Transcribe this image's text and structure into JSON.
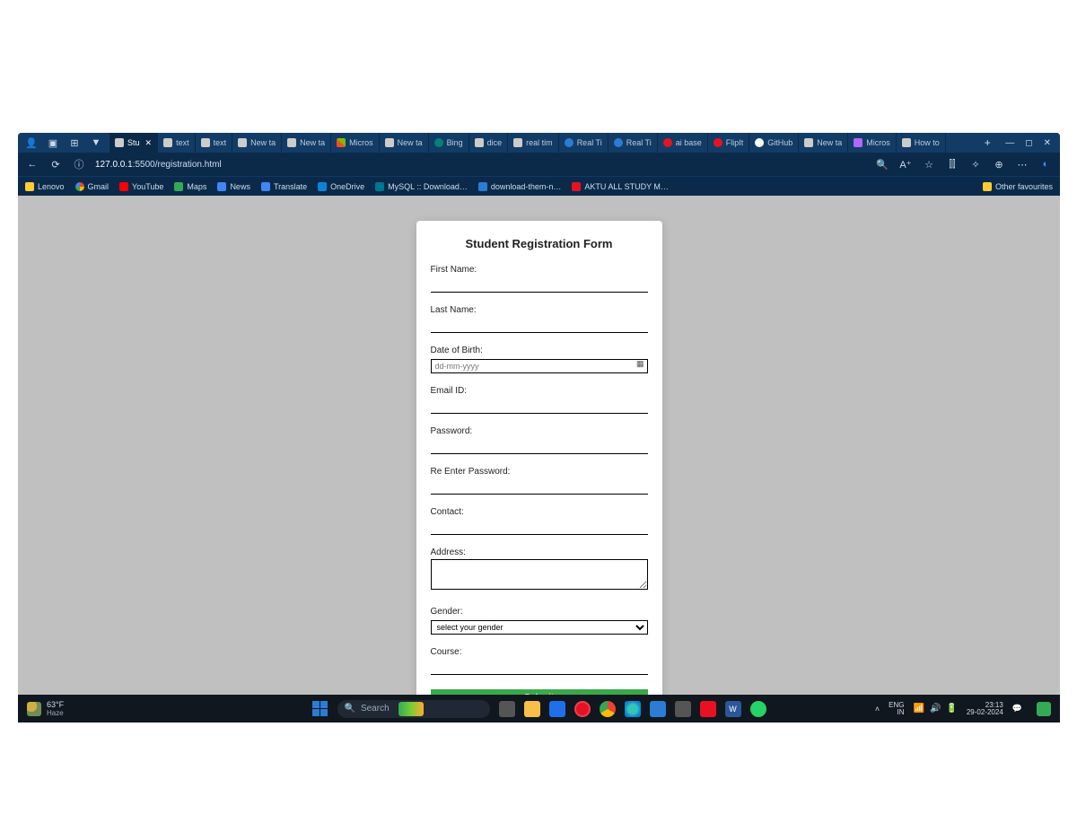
{
  "browser": {
    "url_prefix": "127.0.0.1",
    "url_rest": ":5500/registration.html",
    "tabs": [
      {
        "label": "Stu",
        "icon": "file",
        "active": true
      },
      {
        "label": "text",
        "icon": "file"
      },
      {
        "label": "text",
        "icon": "file"
      },
      {
        "label": "New ta",
        "icon": "file"
      },
      {
        "label": "New ta",
        "icon": "file"
      },
      {
        "label": "Micros",
        "icon": "ms"
      },
      {
        "label": "New ta",
        "icon": "file"
      },
      {
        "label": "Bing",
        "icon": "bing"
      },
      {
        "label": "dice",
        "icon": "file"
      },
      {
        "label": "real tim",
        "icon": "file"
      },
      {
        "label": "Real Ti",
        "icon": "blue"
      },
      {
        "label": "Real Ti",
        "icon": "blue"
      },
      {
        "label": "ai base",
        "icon": "red"
      },
      {
        "label": "FlipIt",
        "icon": "red"
      },
      {
        "label": "GitHub",
        "icon": "gh"
      },
      {
        "label": "New ta",
        "icon": "file"
      },
      {
        "label": "Micros",
        "icon": "wiz"
      },
      {
        "label": "How to",
        "icon": "file"
      }
    ],
    "bookmarks": [
      {
        "label": "Lenovo",
        "icon": "fav"
      },
      {
        "label": "Gmail",
        "icon": "g"
      },
      {
        "label": "YouTube",
        "icon": "yt"
      },
      {
        "label": "Maps",
        "icon": "map"
      },
      {
        "label": "News",
        "icon": "news"
      },
      {
        "label": "Translate",
        "icon": "tr"
      },
      {
        "label": "OneDrive",
        "icon": "od"
      },
      {
        "label": "MySQL :: Download…",
        "icon": "my"
      },
      {
        "label": "download-them-n…",
        "icon": "dl"
      },
      {
        "label": "AKTU ALL STUDY M…",
        "icon": "ak"
      }
    ],
    "other_favourites": "Other favourites"
  },
  "form": {
    "title": "Student Registration Form",
    "first_name": "First Name:",
    "last_name": "Last Name:",
    "dob": "Date of Birth:",
    "dob_placeholder": "dd-mm-yyyy",
    "email": "Email ID:",
    "password": "Password:",
    "repassword": "Re Enter Password:",
    "contact": "Contact:",
    "address": "Address:",
    "gender": "Gender:",
    "gender_placeholder": "select your gender",
    "course": "Course:",
    "submit": "Submit"
  },
  "taskbar": {
    "weather_temp": "63°F",
    "weather_cond": "Haze",
    "search_placeholder": "Search",
    "lang1": "ENG",
    "lang2": "IN",
    "time": "23:13",
    "date": "29-02-2024"
  }
}
